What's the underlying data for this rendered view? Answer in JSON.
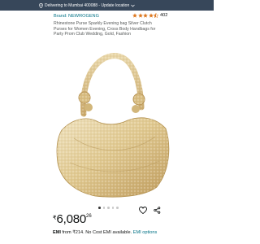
{
  "delivery": {
    "text": "Delivering to Mumbai 400088 - Update location"
  },
  "product": {
    "brand": "Brand: NEWROGENG",
    "rating": 4.5,
    "rating_count": "402",
    "title": "Rhinestone Purse Sparkly Evening bag Silver Clutch Purses for Women Evening, Cross Body Handbags for Party Prom Club Wedding, Gold, Fashion",
    "image_count": 5,
    "active_image": 1
  },
  "price": {
    "symbol": "₹",
    "whole": "6,080",
    "fraction": "26"
  },
  "emi": {
    "label": "EMI",
    "text": " from ₹214. No Cost EMI available.",
    "link": "EMI options"
  },
  "colors": {
    "delivery_bar": "#37475a",
    "link": "#007185",
    "star": "#de7921",
    "text": "#0f1111"
  },
  "icons": [
    "location-pin-icon",
    "chevron-down-icon",
    "star-icon",
    "heart-icon",
    "share-icon"
  ]
}
